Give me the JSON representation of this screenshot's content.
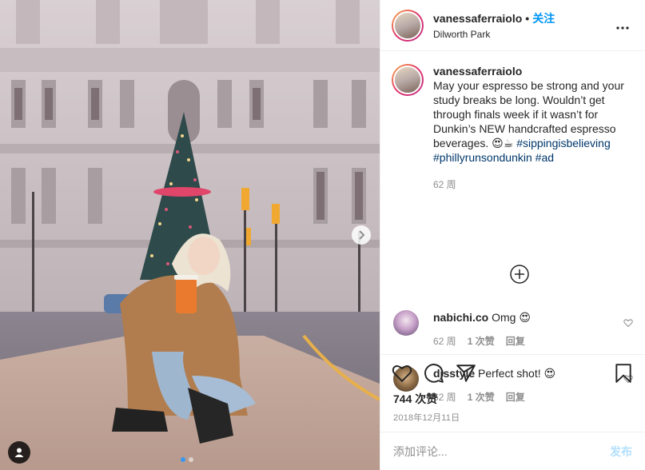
{
  "post": {
    "username": "vanessaferraiolo",
    "separator": "•",
    "follow_label": "关注",
    "location": "Dilworth Park",
    "more_icon": "more-horizontal-icon"
  },
  "caption": {
    "username": "vanessaferraiolo",
    "text": "May your espresso be strong and your study breaks be long. Wouldn’t get through finals week if it wasn’t for Dunkin’s NEW handcrafted espresso beverages. 😍☕ ",
    "hashtags": [
      "#sippingisbelieving",
      "#phillyrunsondunkin",
      "#ad"
    ],
    "time": "62 周"
  },
  "comments": [
    {
      "username": "nabichi.co",
      "text": "Omg 😍",
      "time": "62 周",
      "likes": "1 次赞",
      "reply": "回复"
    },
    {
      "username": "djsstyle",
      "text": "Perfect shot! 😍",
      "time": "62 周",
      "likes": "1 次赞",
      "reply": "回复"
    }
  ],
  "likes_label": "744 次赞",
  "date": "2018年12月11日",
  "composer": {
    "placeholder": "添加评论...",
    "post_label": "发布"
  },
  "colors": {
    "accent": "#0095f6",
    "hashtag": "#00376b",
    "muted": "#8e8e8e",
    "post_disabled": "#b2dffc"
  },
  "carousel": {
    "total": 2,
    "active": 1
  }
}
